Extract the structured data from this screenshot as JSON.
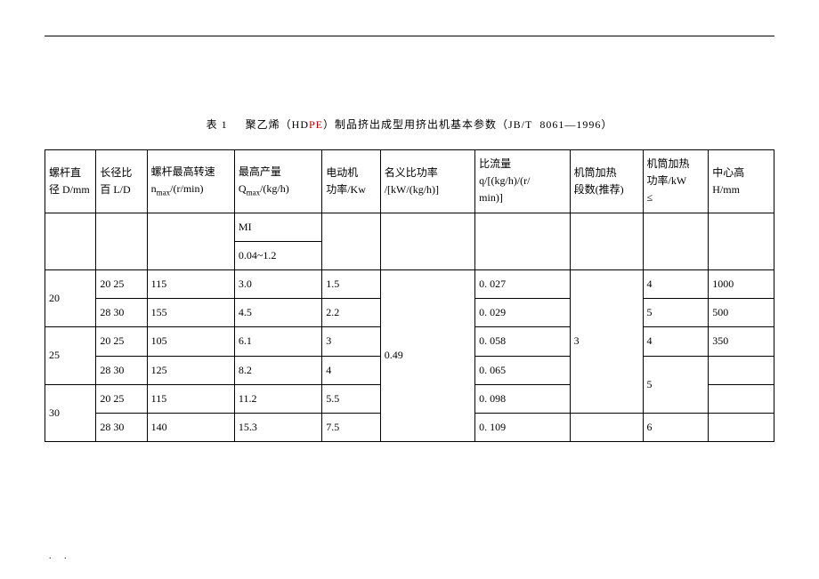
{
  "caption": {
    "prefix": "表 1",
    "gap": "     ",
    "t1": "聚乙烯（HD",
    "pe": "PE",
    "t2": "）制品挤出成型用挤出机基本参数（JB/T  8061—1996）"
  },
  "headers": {
    "h1a": "螺杆直",
    "h1b": "径 D/mm",
    "h2a": "长径比",
    "h2b": "百 L/D",
    "h3a": "螺杆最高转速",
    "h3b": "n",
    "h3sub": "max",
    "h3c": "/(r/min)",
    "h4a": "最高产量",
    "h4b": "Q",
    "h4sub": "max",
    "h4c": "/(kg/h)",
    "h5a": "电动机",
    "h5b": "功率/Kw",
    "h6a": "名义比功率",
    "h6b": "/[kW/(kg/h)]",
    "h7a": "比流量",
    "h7b": "q/[(kg/h)/(r/",
    "h7c": "min)]",
    "h8a": "机筒加热",
    "h8b": "段数(推荐)",
    "h9a": "机筒加热",
    "h9b": "功率/kW",
    "h9c": "≤",
    "h10a": "中心高",
    "h10b": "H/mm"
  },
  "subhead": {
    "mi": "MI",
    "range": "0.04~1.2"
  },
  "rows": [
    {
      "diam": "20",
      "ld": "20 25",
      "nmax": "115",
      "qmax": "3.0",
      "power": "1.5",
      "flow": "0. 027",
      "heatkw": "4",
      "center": "1000"
    },
    {
      "diam": "",
      "ld": "28 30",
      "nmax": "155",
      "qmax": "4.5",
      "power": "2.2",
      "flow": "0. 029",
      "heatkw": "5",
      "center": "500"
    },
    {
      "diam": "25",
      "ld": "20 25",
      "nmax": "105",
      "qmax": "6.1",
      "power": "3",
      "flow": "0. 058",
      "heatkw": "4",
      "center": "350"
    },
    {
      "diam": "",
      "ld": "28 30",
      "nmax": "125",
      "qmax": "8.2",
      "power": "4",
      "flow": "0. 065",
      "heatkw": "",
      "center": ""
    },
    {
      "diam": "30",
      "ld": "20 25",
      "nmax": "115",
      "qmax": "11.2",
      "power": "5.5",
      "flow": "0. 098",
      "heatkw": "",
      "center": ""
    },
    {
      "diam": "",
      "ld": "28 30",
      "nmax": "140",
      "qmax": "15.3",
      "power": "7.5",
      "flow": "0. 109",
      "heatkw": "6",
      "center": ""
    }
  ],
  "span": {
    "nominal": "0.49",
    "segments": "3",
    "heat5": "5"
  },
  "footer": ".   ."
}
